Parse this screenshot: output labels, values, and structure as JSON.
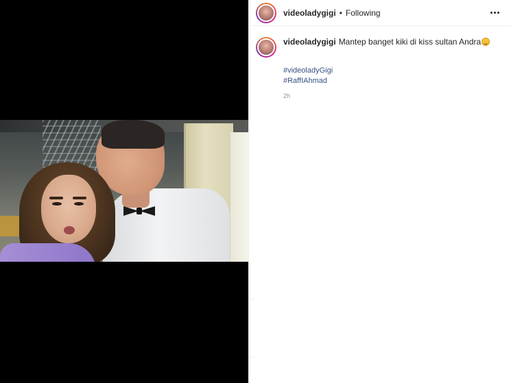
{
  "header": {
    "username": "videoladygigi",
    "separator": "•",
    "follow_label": "Following",
    "more_icon": "more-options-icon"
  },
  "caption": {
    "username": "videoladygigi",
    "text": "Mantep banget kiki di kiss sultan Andra",
    "emoji": "grinning-face-emoji"
  },
  "hashtags": [
    "#videoladyGigi",
    "#RaffIAhmad"
  ],
  "timestamp": "2h",
  "media": {
    "type": "video",
    "description_icon": "video-frame"
  },
  "colors": {
    "link": "#385185",
    "text": "#262626",
    "muted": "#8e8e8e",
    "border": "#efefef"
  }
}
